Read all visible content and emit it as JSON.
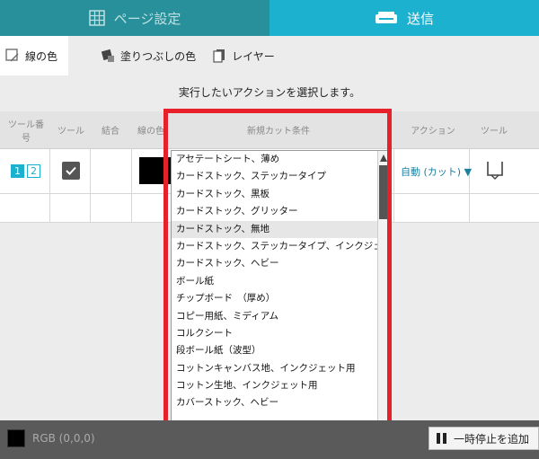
{
  "tabs": {
    "page_setup": "ページ設定",
    "send": "送信"
  },
  "subtabs": {
    "line_color": "線の色",
    "fill_color": "塗りつぶしの色",
    "layer": "レイヤー"
  },
  "instruction": "実行したいアクションを選択します。",
  "table_headers": {
    "tool_number": "ツール番号",
    "tool": "ツール",
    "join": "結合",
    "line_color": "線の色",
    "cut_condition": "新規カット条件",
    "action": "アクション",
    "tool_right": "ツール"
  },
  "row": {
    "tool_numbers": [
      "1",
      "2"
    ],
    "checked": true,
    "swatch_color": "#000000",
    "action_value": "自動 (カット) ▼"
  },
  "dropdown": {
    "items": [
      "アセテートシート、薄め",
      "カードストック、ステッカータイプ",
      "カードストック、黒板",
      "カードストック、グリッター",
      "カードストック、無地",
      "カードストック、ステッカータイプ、インクジェット用",
      "カードストック、ヘビー",
      "ボール紙",
      "チップボード　（厚め）",
      "コピー用紙、ミディアム",
      "コルクシート",
      "段ボール紙（波型）",
      "コットンキャンバス地、インクジェット用",
      "コットン生地、インクジェット用",
      "カバーストック、ヘビー"
    ],
    "selected_index": 4
  },
  "status": {
    "rgb_label": "RGB (0,0,0)",
    "pause_label": "一時停止を追加"
  },
  "colors": {
    "send_tab": "#1cb1cf",
    "page_tab": "#27909a",
    "highlight": "#e8202a"
  }
}
